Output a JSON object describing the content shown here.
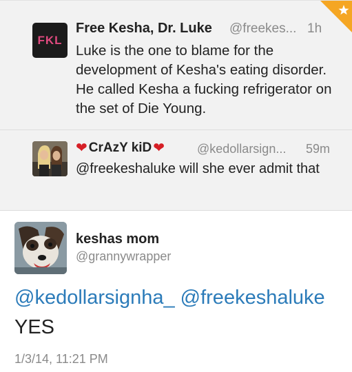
{
  "tweets": [
    {
      "name": "Free Kesha, Dr. Luke",
      "handle": "@freekes...",
      "time": "1h",
      "avatar_text": "FKL",
      "text": "Luke is the one to blame for the development of Kesha's eating disorder. He called Kesha a fucking refrigerator on the set of Die Young."
    },
    {
      "name": "CrAzY kiD",
      "name_prefix_icon": "heart-icon",
      "name_suffix_icon": "heart-icon",
      "handle": "@kedollarsign...",
      "time": "59m",
      "text": "@freekeshaluke will she ever admit that"
    }
  ],
  "detail_tweet": {
    "name": "keshas mom",
    "handle": "@grannywrapper",
    "mention1": "@kedollarsignha_",
    "mention2": "@freekeshaluke",
    "text": "YES",
    "date": "1/3/14, 11:21 PM"
  },
  "colors": {
    "link": "#2b7bb9",
    "favorite_corner": "#f5a623",
    "heart": "#d61f26"
  }
}
